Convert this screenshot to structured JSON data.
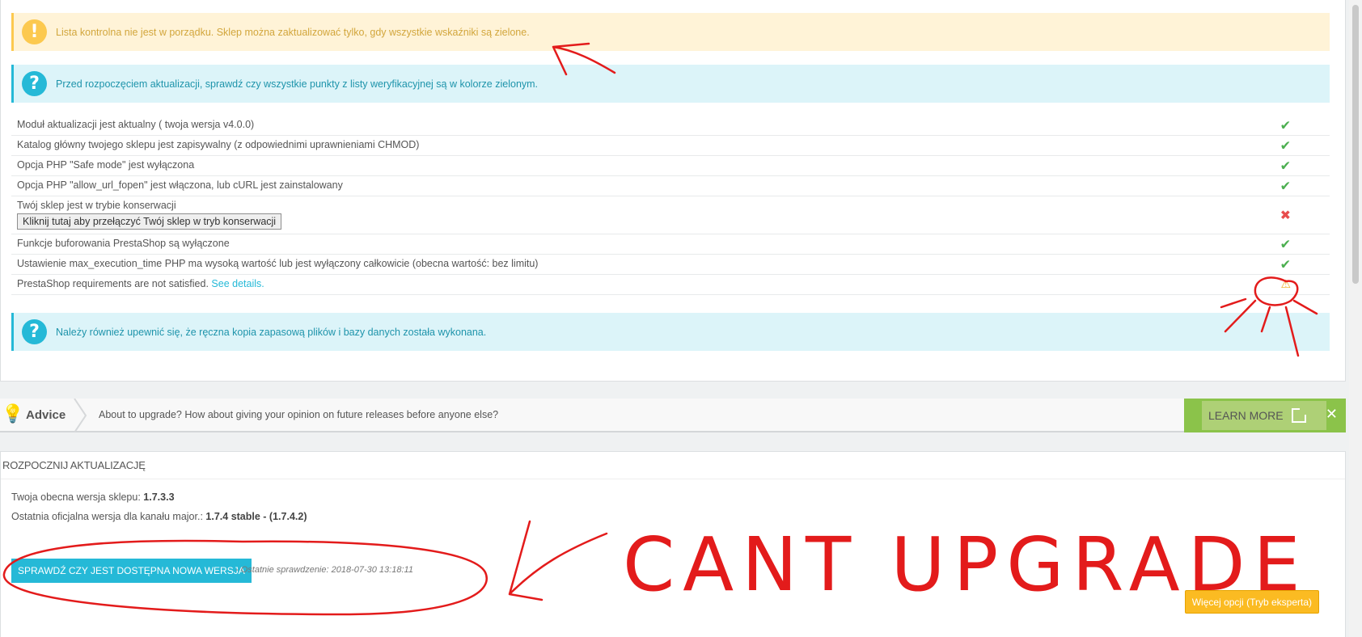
{
  "alerts": {
    "warning": "Lista kontrolna nie jest w porządku. Sklep można zaktualizować tylko, gdy wszystkie wskaźniki są zielone.",
    "info_before": "Przed rozpoczęciem aktualizacji, sprawdź czy wszystkie punkty z listy weryfikacyjnej są w kolorze zielonym.",
    "info_backup": "Należy również upewnić się, że ręczna kopia zapasową plików i bazy danych została wykonana."
  },
  "checklist": [
    {
      "label": "Moduł aktualizacji jest aktualny ( twoja wersja v4.0.0)",
      "status": "ok"
    },
    {
      "label": "Katalog główny twojego sklepu jest zapisywalny (z odpowiednimi uprawnieniami CHMOD)",
      "status": "ok"
    },
    {
      "label": "Opcja PHP \"Safe mode\" jest wyłączona",
      "status": "ok"
    },
    {
      "label": "Opcja PHP \"allow_url_fopen\" jest włączona, lub cURL jest zainstalowany",
      "status": "ok"
    },
    {
      "label": "Twój sklep jest w trybie konserwacji",
      "status": "fail",
      "button": "Kliknij tutaj aby przełączyć Twój sklep w tryb konserwacji"
    },
    {
      "label": "Funkcje buforowania PrestaShop są wyłączone",
      "status": "ok"
    },
    {
      "label": "Ustawienie max_execution_time PHP ma wysoką wartość lub jest wyłączony całkowicie (obecna wartość: bez limitu)",
      "status": "ok"
    },
    {
      "label": "PrestaShop requirements are not satisfied.",
      "link": "See details.",
      "status": "warn"
    }
  ],
  "icons": {
    "warning": "!",
    "question": "?",
    "ok": "✔",
    "fail": "✖",
    "warn": "⚠",
    "bulb": "💡",
    "close": "✕"
  },
  "advice": {
    "title": "Advice",
    "message": "About to upgrade? How about giving your opinion on future releases before anyone else?",
    "learn_more": "LEARN MORE"
  },
  "upgrade": {
    "heading": "ROZPOCZNIJ AKTUALIZACJĘ",
    "current_label": "Twoja obecna wersja sklepu:",
    "current_value": "1.7.3.3",
    "latest_label": "Ostatnia oficjalna wersja dla kanału major.:",
    "latest_value": "1.7.4 stable - (1.7.4.2)",
    "check_button": "SPRAWDŹ CZY JEST DOSTĘPNA NOWA WERSJA",
    "last_check": "- Ostatnie sprawdzenie: 2018-07-30 13:18:11",
    "expert_button": "Więcej opcji (Tryb eksperta)"
  },
  "annotation_text": "CANT UPGRADE",
  "colors": {
    "info": "#25b9d7",
    "warning": "#fcc94f",
    "ok": "#4caf50",
    "fail": "#e84c4c",
    "advice": "#8bc34a",
    "annotation": "#e31b1b"
  }
}
